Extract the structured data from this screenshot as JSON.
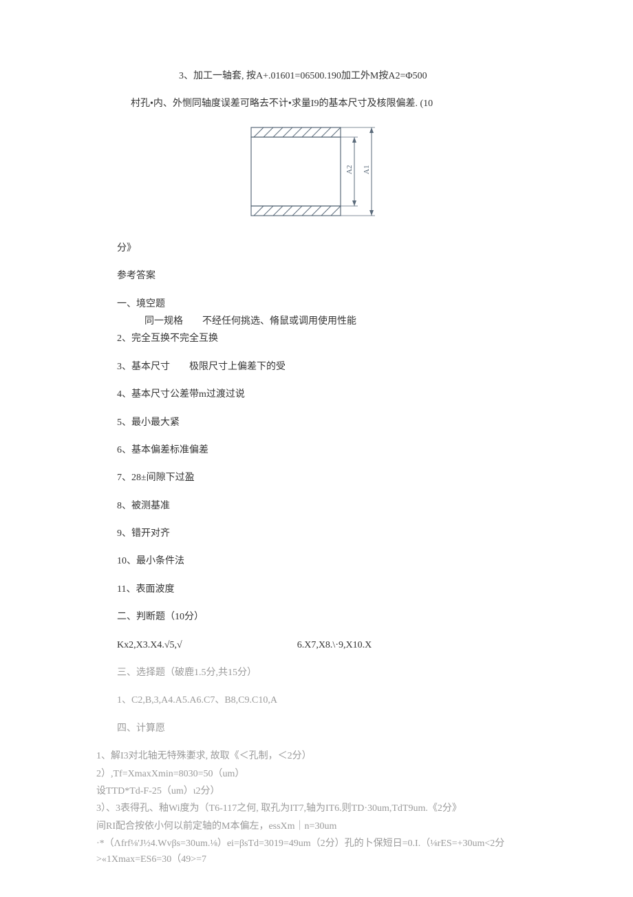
{
  "p1": "3、加工一轴套, 按A+.01601=06500.190加工外M按A2=Φ500",
  "p2": "村孔•内、外恻同轴度误差可略去不计•求量I9的基本尺寸及核限偏差. (10",
  "diagram_labels": {
    "a2": "A2",
    "a1": "A1"
  },
  "p3": "分》",
  "p4": "参考答案",
  "p5": "一、境空题",
  "p5a": "同一规格　　不经任何挑选、脩鼠或调用使用性能",
  "p6": "2、完全互换不完全互换",
  "p7": "3、基本尺寸　　极限尺寸上偏差下的受",
  "p8": "4、基本尺寸公差带m过渡过说",
  "p9": "5、最小最大紧",
  "p10": "6、基本偏差标准偏差",
  "p11": "7、28±间隙下过盈",
  "p12": "8、被测基准",
  "p13": "9、错开对齐",
  "p14": "10、最小条件法",
  "p15": "11、表面波度",
  "p16": "二、判断题（10分）",
  "p17a": "Kx2,X3.X4.√5,√",
  "p17b": "6.X7,X8.\\·9,X10.X",
  "p18": "三、选择题（破鹿1.5分,共15分）",
  "p19": "1、C2,B,3,A4.A5.A6.C7、B8,C9.C10,A",
  "p20": "四、计算愿",
  "p21": "1、解I3对北轴无特殊嬱求, 故取《＜孔制，＜2分）",
  "p22": "2）,Tf=XmaxXmin=8030=50（um）",
  "p23": "设TTD*Td-F-25（um）ι2分）",
  "p24": "3）、3表得孔、釉Wi度为（T6-117之何, 取孔为IT7,轴为IT6.则TD·30um,TdT9um.《2分》",
  "p25": "间RI配合按依小何以前定轴的M本偏左，essXm｜n=30um",
  "p26": "·*（Λfrf⅛'J½4.Wvβs=30um.⅛）ei=βsTd=3019=49um（2分）孔的卜保短日=0.I.（⅛rES=+30um<2分>«1Xmax=ES6=30（49>=7"
}
